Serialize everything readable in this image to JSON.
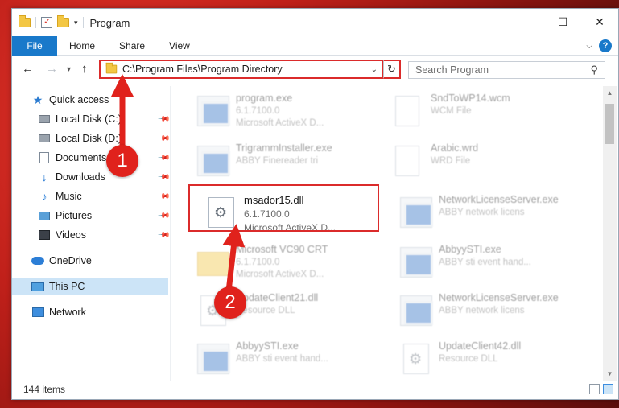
{
  "window": {
    "title": "Program",
    "buttons": {
      "minimize": "—",
      "maximize": "☐",
      "close": "✕"
    }
  },
  "ribbon": {
    "tabs": [
      "File",
      "Home",
      "Share",
      "View"
    ],
    "help": "?"
  },
  "address": {
    "path": "C:\\Program Files\\Program Directory",
    "search_placeholder": "Search Program"
  },
  "sidebar": {
    "items": [
      {
        "label": "Quick access"
      },
      {
        "label": "Local Disk (C:)"
      },
      {
        "label": "Local Disk (D:)"
      },
      {
        "label": "Documents"
      },
      {
        "label": "Downloads"
      },
      {
        "label": "Music"
      },
      {
        "label": "Pictures"
      },
      {
        "label": "Videos"
      },
      {
        "label": "OneDrive"
      },
      {
        "label": "This PC"
      },
      {
        "label": "Network"
      }
    ]
  },
  "files": [
    {
      "name": "program.exe",
      "line1": "6.1.7100.0",
      "line2": "Microsoft ActiveX D..."
    },
    {
      "name": "SndToWP14.wcm",
      "line1": "WCM File",
      "line2": ""
    },
    {
      "name": "TrigrammInstaller.exe",
      "line1": "ABBY Finereader tri",
      "line2": ""
    },
    {
      "name": "Arabic.wrd",
      "line1": "WRD File",
      "line2": ""
    },
    {
      "name": "msador15.dll",
      "line1": "6.1.7100.0",
      "line2": "Microsoft ActiveX D..."
    },
    {
      "name": "NetworkLicenseServer.exe",
      "line1": "ABBY network licens",
      "line2": ""
    },
    {
      "name": "Microsoft VC90 CRT",
      "line1": "6.1.7100.0",
      "line2": "Microsoft ActiveX D..."
    },
    {
      "name": "AbbyySTI.exe",
      "line1": "ABBY sti event hand...",
      "line2": ""
    },
    {
      "name": "UpdateClient21.dll",
      "line1": "Resource DLL",
      "line2": ""
    },
    {
      "name": "NetworkLicenseServer.exe",
      "line1": "ABBY network licens",
      "line2": ""
    },
    {
      "name": "AbbyySTI.exe",
      "line1": "ABBY sti event hand...",
      "line2": ""
    },
    {
      "name": "UpdateClient42.dll",
      "line1": "Resource DLL",
      "line2": ""
    }
  ],
  "status": {
    "count": "144 items"
  },
  "callouts": {
    "one": "1",
    "two": "2"
  },
  "colors": {
    "highlight": "#db2b2b",
    "badge": "#e0221c",
    "accent": "#1979ca"
  }
}
